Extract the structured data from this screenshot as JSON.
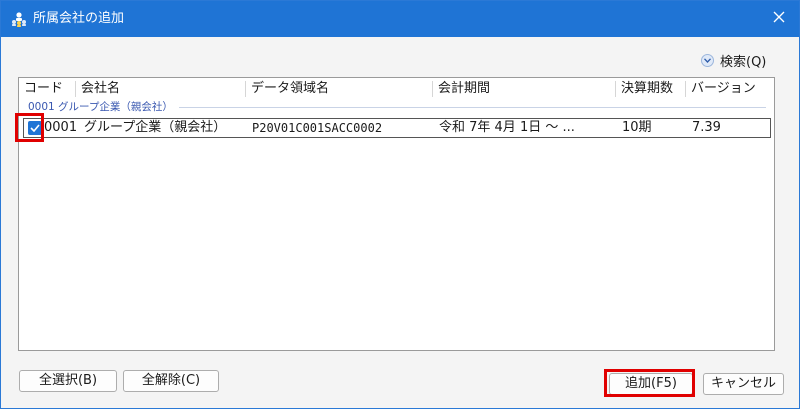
{
  "window": {
    "title": "所属会社の追加",
    "close_label": "×"
  },
  "search": {
    "label": "検索(Q)",
    "chevron": "▼"
  },
  "grid": {
    "columns": [
      "コード",
      "会社名",
      "データ領域名",
      "会計期間",
      "決算期数",
      "バージョン"
    ],
    "group_label": "0001 グループ企業（親会社）",
    "rows": [
      {
        "checked": true,
        "code": "0001",
        "company": "グループ企業（親会社）",
        "data_area": "P20V01C001SACC0002",
        "period": "令和 7年 4月 1日 ～ ...",
        "fiscal_count": "10期",
        "version": "7.39"
      }
    ]
  },
  "buttons": {
    "select_all": "全選択(B)",
    "deselect_all": "全解除(C)",
    "add": "追加(F5)",
    "cancel": "キャンセル"
  },
  "colors": {
    "titlebar": "#1f74d5",
    "checkbox": "#1f74d5",
    "highlight": "#e00000",
    "group_text": "#3a58b0"
  }
}
